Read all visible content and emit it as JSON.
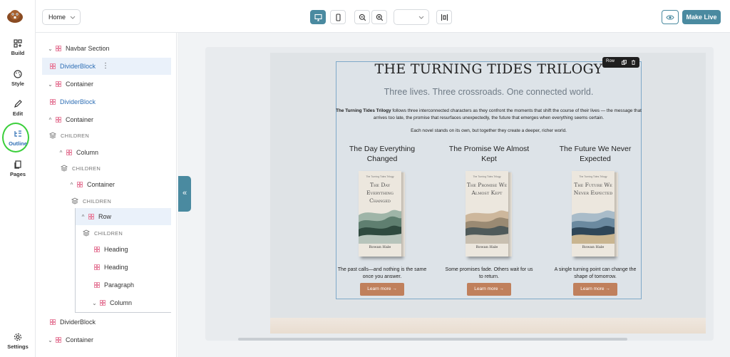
{
  "sidebar": {
    "items": [
      {
        "label": "Build",
        "icon": "build-icon"
      },
      {
        "label": "Style",
        "icon": "palette-icon"
      },
      {
        "label": "Edit",
        "icon": "pencil-icon"
      },
      {
        "label": "Outline",
        "icon": "outline-icon",
        "active": true
      },
      {
        "label": "Pages",
        "icon": "pages-icon"
      }
    ],
    "settings_label": "Settings"
  },
  "topbar": {
    "page_select": "Home",
    "make_live_label": "Make Live"
  },
  "outline": {
    "navbar_section": "Navbar Section",
    "divider_block_1": "DividerBlock",
    "container_1": "Container",
    "divider_block_2": "DividerBlock",
    "container_2": "Container",
    "children_1": "CHILDREN",
    "column_1": "Column",
    "children_2": "CHILDREN",
    "container_3": "Container",
    "children_3": "CHILDREN",
    "row": "Row",
    "children_4": "CHILDREN",
    "heading_1": "Heading",
    "heading_2": "Heading",
    "paragraph": "Paragraph",
    "column_2": "Column",
    "divider_block_3": "DividerBlock",
    "container_4": "Container"
  },
  "canvas": {
    "row_tag": "Row",
    "title": "THE TURNING TIDES TRILOGY",
    "subtitle": "Three lives. Three crossroads. One connected world.",
    "intro_bold": "The Turning Tides Trilogy",
    "intro_rest": " follows three interconnected characters as they confront the moments that shift the course of their lives — the message that arrives too late, the promise that resurfaces unexpectedly, the future that emerges when everything seems certain.",
    "intro2": "Each novel stands on its own, but together they create a deeper, richer world.",
    "books": [
      {
        "title": "The Day Everything Changed",
        "cover_series": "The Turning Tides Trilogy",
        "cover_title": "The Day Everything Changed",
        "author": "Rowan Hale",
        "desc": "The past calls—and nothing is the same once you answer.",
        "cta": "Learn more"
      },
      {
        "title": "The Promise We Almost Kept",
        "cover_series": "The Turning Tides Trilogy",
        "cover_title": "The Promise We Almost Kept",
        "author": "Rowan Hale",
        "desc": "Some promises fade. Others wait for us to return.",
        "cta": "Learn more"
      },
      {
        "title": "The Future We Never Expected",
        "cover_series": "The Turning Tides Trilogy",
        "cover_title": "The Future We Never Expected",
        "author": "Rowan Hale",
        "desc": "A single turning point can change the shape of tomorrow.",
        "cta": "Learn more"
      }
    ]
  },
  "colors": {
    "accent": "#4a8aa0",
    "link_blue": "#2f6fb5",
    "cta_brown": "#c0805c",
    "highlight_green": "#3bcf3b"
  }
}
